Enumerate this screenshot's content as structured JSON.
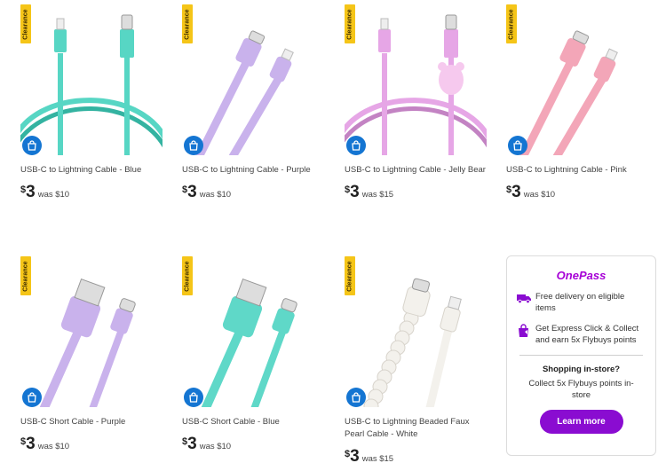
{
  "products": [
    {
      "badge": "Clearance",
      "name": "USB-C to Lightning Cable - Blue",
      "currency": "$",
      "price": "3",
      "was": "was $10",
      "color": "#57d6c4",
      "variant": "coiled-straight"
    },
    {
      "badge": "Clearance",
      "name": "USB-C to Lightning Cable - Purple",
      "currency": "$",
      "price": "3",
      "was": "was $10",
      "color": "#c9b2ec",
      "variant": "diagonal"
    },
    {
      "badge": "Clearance",
      "name": "USB-C to Lightning Cable - Jelly Bear",
      "currency": "$",
      "price": "3",
      "was": "was $15",
      "color": "#e6a6e6",
      "variant": "coiled-bear"
    },
    {
      "badge": "Clearance",
      "name": "USB-C to Lightning Cable - Pink",
      "currency": "$",
      "price": "3",
      "was": "was $10",
      "color": "#f3a6b8",
      "variant": "diagonal"
    },
    {
      "badge": "Clearance",
      "name": "USB-C Short Cable - Purple",
      "currency": "$",
      "price": "3",
      "was": "was $10",
      "color": "#c9b2ec",
      "variant": "usb-a"
    },
    {
      "badge": "Clearance",
      "name": "USB-C Short Cable - Blue",
      "currency": "$",
      "price": "3",
      "was": "was $10",
      "color": "#5fd8c8",
      "variant": "usb-a"
    },
    {
      "badge": "Clearance",
      "name": "USB-C to Lightning Beaded Faux Pearl Cable - White",
      "currency": "$",
      "price": "3",
      "was": "was $15",
      "color": "#f3f1ec",
      "variant": "beaded"
    }
  ],
  "icons": {
    "badge_icon": "clearance-tag",
    "cart_icon": "shopping-bag-icon"
  },
  "onepass": {
    "logo": "OnePass",
    "feature1": "Free delivery on eligible items",
    "feature2": "Get Express Click & Collect and earn 5x Flybuys points",
    "instore_title": "Shopping in-store?",
    "instore_text": "Collect 5x Flybuys points in-store",
    "button": "Learn more",
    "brand_color": "#8a0cd1"
  }
}
